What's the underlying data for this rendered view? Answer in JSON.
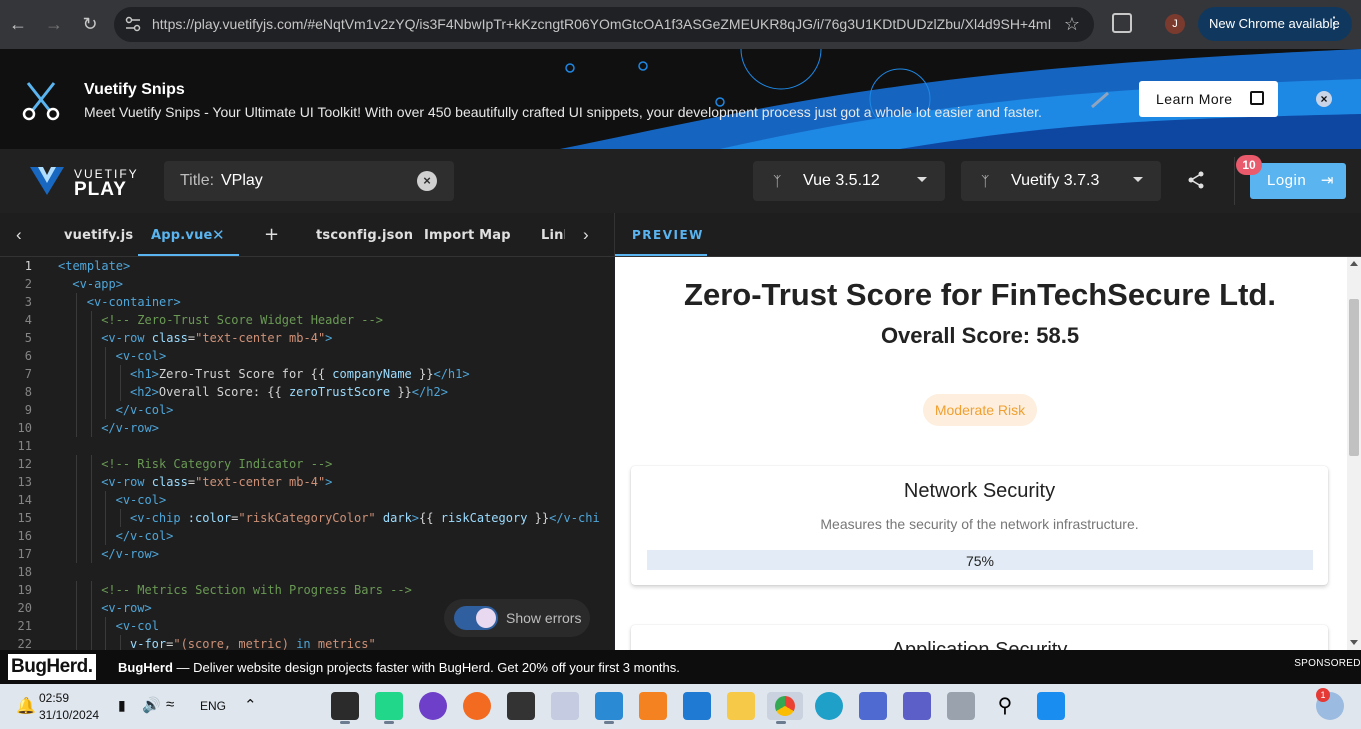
{
  "browser": {
    "url": "https://play.vuetifyjs.com/#eNqtVm1v2zYQ/is3F4NbwIpTr+kKzcngtR06YOmGtcOA1f3ASGeZMEUKR8qJG/i/76g3U1KDtDUDzlZbu/Xl4d9SH+4mIZL...",
    "profile_initial": "J",
    "new_chrome_label": "New Chrome available"
  },
  "banner": {
    "title": "Vuetify Snips",
    "description": "Meet Vuetify Snips - Your Ultimate UI Toolkit! With over 450 beautifully crafted UI snippets, your development process just got a whole lot easier and faster.",
    "learn_more": "Learn More"
  },
  "appbar": {
    "logo_top": "VUETIFY",
    "logo_bottom": "PLAY",
    "title_label": "Title:",
    "title_value": "VPlay",
    "vue_label": "Vue",
    "vue_version": "3.5.12",
    "vuetify_label": "Vuetify",
    "vuetify_version": "3.7.3",
    "login": "Login",
    "notifications": "10"
  },
  "tabs": [
    {
      "label": "vuetify.js"
    },
    {
      "label": "App.vue"
    },
    {
      "label": "tsconfig.json"
    },
    {
      "label": "Import Map"
    },
    {
      "label": "Link"
    }
  ],
  "preview_tab": "PREVIEW",
  "editor": {
    "show_errors": "Show errors",
    "lines": [
      {
        "n": "1",
        "indent": 0,
        "parts": [
          [
            "tag",
            "<template>"
          ]
        ]
      },
      {
        "n": "2",
        "indent": 1,
        "parts": [
          [
            "tag",
            "<v-app>"
          ]
        ]
      },
      {
        "n": "3",
        "indent": 2,
        "parts": [
          [
            "tag",
            "<v-container>"
          ]
        ]
      },
      {
        "n": "4",
        "indent": 3,
        "parts": [
          [
            "com",
            "<!-- Zero-Trust Score Widget Header -->"
          ]
        ]
      },
      {
        "n": "5",
        "indent": 3,
        "parts": [
          [
            "tag",
            "<v-row "
          ],
          [
            "attr",
            "class"
          ],
          [
            "txt",
            "="
          ],
          [
            "str",
            "\"text-center mb-4\""
          ],
          [
            "tag",
            ">"
          ]
        ]
      },
      {
        "n": "6",
        "indent": 4,
        "parts": [
          [
            "tag",
            "<v-col>"
          ]
        ]
      },
      {
        "n": "7",
        "indent": 5,
        "parts": [
          [
            "tag",
            "<h1>"
          ],
          [
            "txt",
            "Zero-Trust Score for {{ "
          ],
          [
            "var",
            "companyName"
          ],
          [
            "txt",
            " }}"
          ],
          [
            "tag",
            "</h1>"
          ]
        ]
      },
      {
        "n": "8",
        "indent": 5,
        "parts": [
          [
            "tag",
            "<h2>"
          ],
          [
            "txt",
            "Overall Score: {{ "
          ],
          [
            "var",
            "zeroTrustScore"
          ],
          [
            "txt",
            " }}"
          ],
          [
            "tag",
            "</h2>"
          ]
        ]
      },
      {
        "n": "9",
        "indent": 4,
        "parts": [
          [
            "tag",
            "</v-col>"
          ]
        ]
      },
      {
        "n": "10",
        "indent": 3,
        "parts": [
          [
            "tag",
            "</v-row>"
          ]
        ]
      },
      {
        "n": "11",
        "indent": 0,
        "parts": []
      },
      {
        "n": "12",
        "indent": 3,
        "parts": [
          [
            "com",
            "<!-- Risk Category Indicator -->"
          ]
        ]
      },
      {
        "n": "13",
        "indent": 3,
        "parts": [
          [
            "tag",
            "<v-row "
          ],
          [
            "attr",
            "class"
          ],
          [
            "txt",
            "="
          ],
          [
            "str",
            "\"text-center mb-4\""
          ],
          [
            "tag",
            ">"
          ]
        ]
      },
      {
        "n": "14",
        "indent": 4,
        "parts": [
          [
            "tag",
            "<v-col>"
          ]
        ]
      },
      {
        "n": "15",
        "indent": 5,
        "parts": [
          [
            "tag",
            "<v-chip "
          ],
          [
            "attr",
            ":color"
          ],
          [
            "txt",
            "="
          ],
          [
            "str",
            "\"riskCategoryColor\""
          ],
          [
            "attr",
            " dark"
          ],
          [
            "tag",
            ">"
          ],
          [
            "txt",
            "{{ "
          ],
          [
            "var",
            "riskCategory"
          ],
          [
            "txt",
            " }}"
          ],
          [
            "tag",
            "</v-chip>"
          ]
        ]
      },
      {
        "n": "16",
        "indent": 4,
        "parts": [
          [
            "tag",
            "</v-col>"
          ]
        ]
      },
      {
        "n": "17",
        "indent": 3,
        "parts": [
          [
            "tag",
            "</v-row>"
          ]
        ]
      },
      {
        "n": "18",
        "indent": 0,
        "parts": []
      },
      {
        "n": "19",
        "indent": 3,
        "parts": [
          [
            "com",
            "<!-- Metrics Section with Progress Bars -->"
          ]
        ]
      },
      {
        "n": "20",
        "indent": 3,
        "parts": [
          [
            "tag",
            "<v-row>"
          ]
        ]
      },
      {
        "n": "21",
        "indent": 4,
        "parts": [
          [
            "tag",
            "<v-col"
          ]
        ]
      },
      {
        "n": "22",
        "indent": 5,
        "parts": [
          [
            "attr",
            "v-for"
          ],
          [
            "txt",
            "="
          ],
          [
            "str",
            "\"(score, metric) "
          ],
          [
            "tag",
            "in"
          ],
          [
            "str",
            " metrics\""
          ]
        ]
      }
    ]
  },
  "preview": {
    "heading": "Zero-Trust Score for FinTechSecure Ltd.",
    "overall": "Overall Score: 58.5",
    "risk_chip": "Moderate Risk",
    "cards": [
      {
        "title": "Network Security",
        "description": "Measures the security of the network infrastructure.",
        "progress_label": "75%",
        "progress": 0.75
      },
      {
        "title": "Application Security",
        "description": "",
        "progress_label": "",
        "progress": 0
      }
    ]
  },
  "ad": {
    "logo": "BugHerd.",
    "brand": "BugHerd",
    "text": " — Deliver website design projects faster with BugHerd. Get 20% off your first 3 months.",
    "sponsored": "SPONSORED"
  },
  "taskbar": {
    "time": "02:59",
    "date": "31/10/2024",
    "lang": "ENG",
    "weather_badge": "1"
  },
  "colors": {
    "accent": "#5ab4ef",
    "chip_bg": "#fdeedd",
    "chip_text": "#f0a030",
    "progress_bg": "#e3ecf6"
  }
}
